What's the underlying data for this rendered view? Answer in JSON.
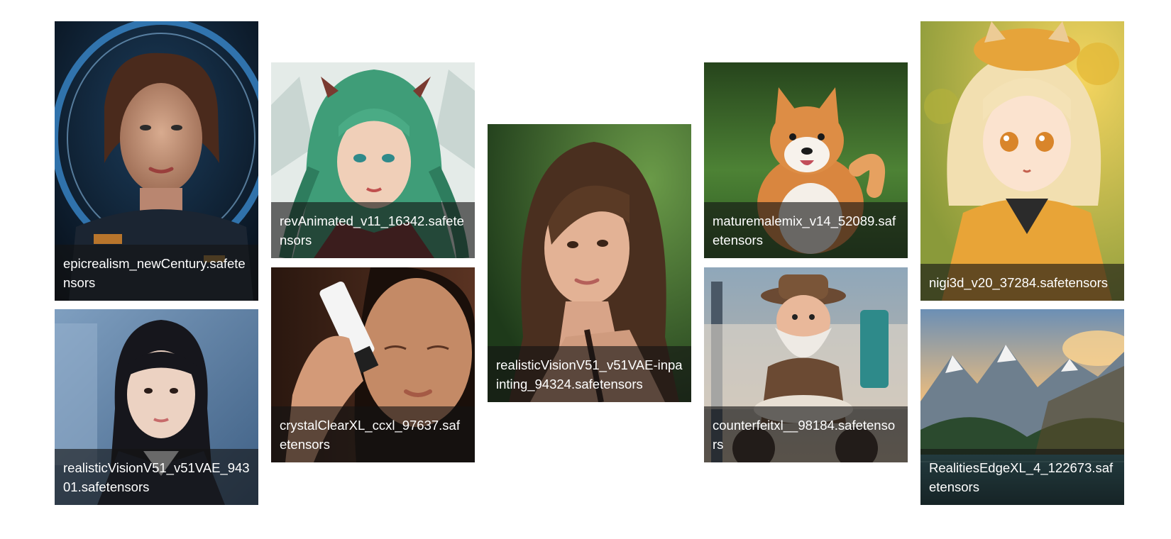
{
  "gallery": {
    "items": [
      {
        "model": "epicrealism_newCentury.safetensors",
        "subject": "woman-astronaut-portrait",
        "palette": [
          "#0b1a2a",
          "#2b6fa8",
          "#c99a7e"
        ]
      },
      {
        "model": "realisticVisionV51_v51VAE_94301.safetensors",
        "subject": "girl-school-uniform-portrait",
        "palette": [
          "#5c7fa4",
          "#1c1c22",
          "#e8cdbd"
        ]
      },
      {
        "model": "revAnimated_v11_16342.safetensors",
        "subject": "green-haired-fantasy-girl",
        "palette": [
          "#dfe6e2",
          "#3f9d78",
          "#e9c2a8"
        ]
      },
      {
        "model": "crystalClearXL_ccxl_97637.safetensors",
        "subject": "woman-holding-cosmetic-tube",
        "palette": [
          "#3b2418",
          "#b87a55",
          "#f2f2f2"
        ]
      },
      {
        "model": "realisticVisionV51_v51VAE-inpainting_94324.safetensors",
        "subject": "brunette-woman-outdoor-portrait",
        "palette": [
          "#2f5a2a",
          "#5a3a25",
          "#d9a88a"
        ]
      },
      {
        "model": "maturemalemix_v14_52089.safetensors",
        "subject": "shiba-inu-dog-on-grass",
        "palette": [
          "#3d6a2c",
          "#d98a45",
          "#f4efe8"
        ]
      },
      {
        "model": "counterfeitxl__98184.safetensors",
        "subject": "bearded-old-man-on-motorbike",
        "palette": [
          "#6f8a9e",
          "#6b4a33",
          "#e9e4de"
        ]
      },
      {
        "model": "nigi3d_v20_37284.safetensors",
        "subject": "blonde-anime-girl-yellow-hoodie",
        "palette": [
          "#e8c447",
          "#f2dfb0",
          "#e6a43a"
        ]
      },
      {
        "model": "RealitiesEdgeXL_4_122673.safetensors",
        "subject": "mountain-lake-sunset",
        "palette": [
          "#f2a65a",
          "#6e7f8e",
          "#2b4a2e"
        ]
      }
    ]
  }
}
